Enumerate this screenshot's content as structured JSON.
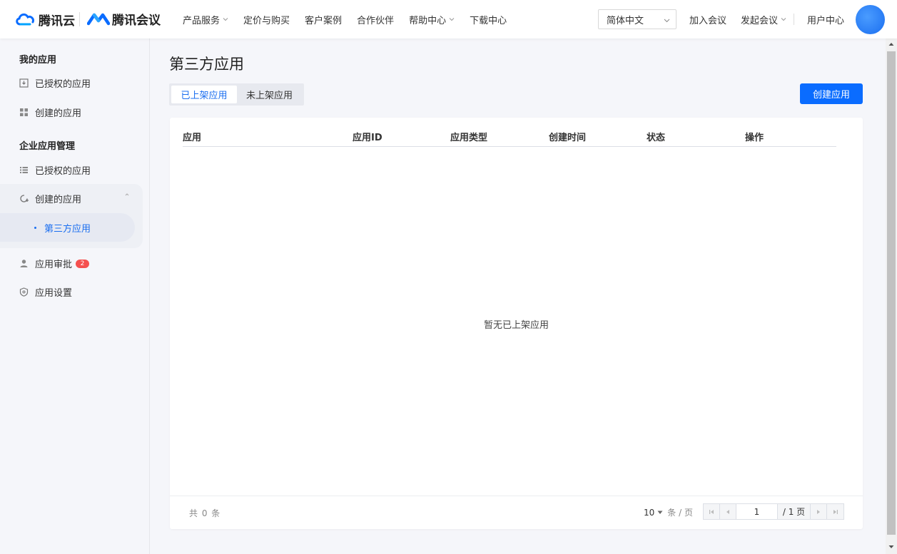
{
  "header": {
    "brand_cloud": "腾讯云",
    "brand_meeting": "腾讯会议",
    "nav": [
      {
        "label": "产品服务",
        "has_dropdown": true
      },
      {
        "label": "定价与购买",
        "has_dropdown": false
      },
      {
        "label": "客户案例",
        "has_dropdown": false
      },
      {
        "label": "合作伙伴",
        "has_dropdown": false
      },
      {
        "label": "帮助中心",
        "has_dropdown": true
      },
      {
        "label": "下载中心",
        "has_dropdown": false
      }
    ],
    "language": "简体中文",
    "join_meeting": "加入会议",
    "start_meeting": "发起会议",
    "user_center": "用户中心"
  },
  "sidebar": {
    "my_apps_title": "我的应用",
    "my_apps": [
      {
        "label": "已授权的应用",
        "icon": "download-box-icon"
      },
      {
        "label": "创建的应用",
        "icon": "grid-icon"
      }
    ],
    "enterprise_title": "企业应用管理",
    "enterprise_items": [
      {
        "label": "已授权的应用",
        "icon": "list-icon"
      },
      {
        "label": "创建的应用",
        "icon": "refresh-plus-icon",
        "expanded": true
      }
    ],
    "sub_item": "第三方应用",
    "approval": {
      "label": "应用审批",
      "badge": "2"
    },
    "settings": {
      "label": "应用设置"
    }
  },
  "main": {
    "title": "第三方应用",
    "tabs": [
      {
        "label": "已上架应用",
        "active": true
      },
      {
        "label": "未上架应用",
        "active": false
      }
    ],
    "create_button": "创建应用",
    "table": {
      "columns": [
        "应用",
        "应用ID",
        "应用类型",
        "创建时间",
        "状态",
        "操作"
      ],
      "empty_text": "暂无已上架应用"
    },
    "pagination": {
      "total_text": "共 0 条",
      "page_size": "10",
      "page_size_unit": "条 / 页",
      "current_page": "1",
      "total_pages": "/ 1 页"
    }
  },
  "colors": {
    "accent": "#0a6cff",
    "badge": "#f5504f",
    "sidebar_bg": "#f5f6fa"
  }
}
